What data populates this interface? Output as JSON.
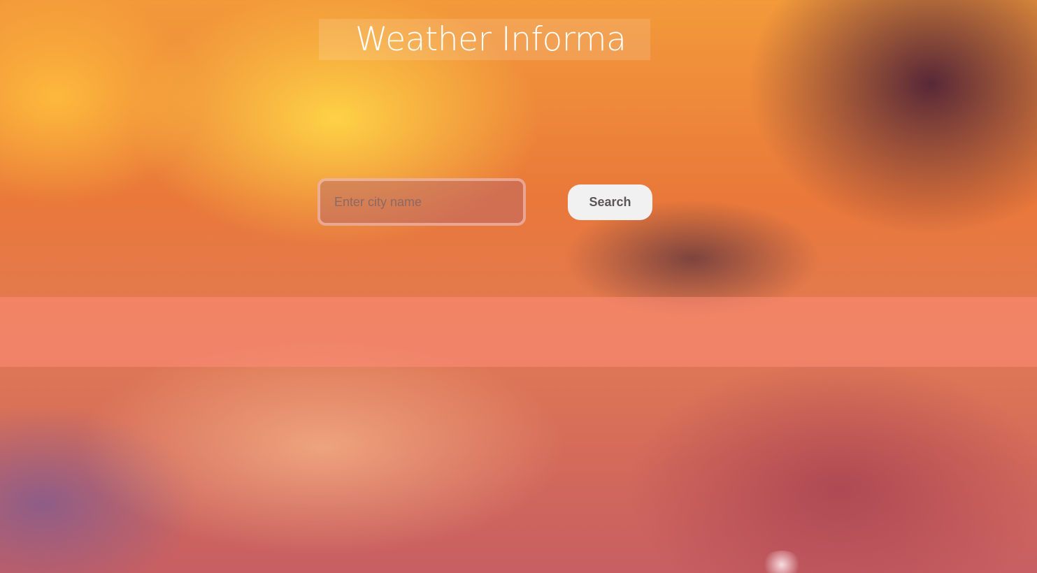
{
  "header": {
    "title": "Weather Informa"
  },
  "search": {
    "placeholder": "Enter city name",
    "value": "",
    "button_label": "Search"
  },
  "colors": {
    "title_text": "#ffffff",
    "button_bg": "#f2f1f1",
    "button_text": "#5b5557",
    "result_band": "#ff8c78"
  }
}
